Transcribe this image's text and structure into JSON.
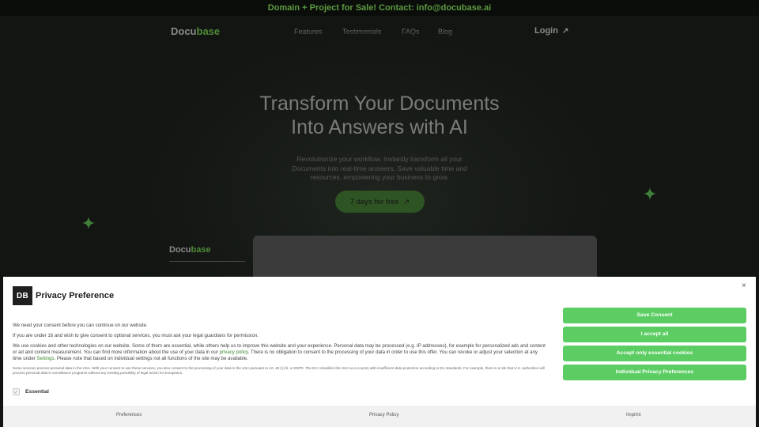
{
  "topbar": {
    "text": "Domain + Project for Sale! Contact: info@docubase.ai"
  },
  "nav": {
    "logo_main": "Docu",
    "logo_accent": "base",
    "links": [
      "Features",
      "Testimonials",
      "FAQs",
      "Blog"
    ],
    "login_label": "Login",
    "login_arrow": "↗"
  },
  "hero": {
    "title_line1": "Transform Your Documents",
    "title_line2": "Into Answers with AI",
    "subtitle": "Revolutionize your workflow. Instantly transform all your Documents into real-time answers. Save valuable time and resources, empowering your business to grow.",
    "cta_label": "7 days for free",
    "cta_arrow": "↗"
  },
  "preview": {
    "logo_main": "Docu",
    "logo_accent": "base"
  },
  "consent": {
    "badge": "DB",
    "title": "Privacy Preference",
    "close_glyph": "×",
    "p1": "We need your consent before you can continue on our website.",
    "p2": "If you are under 16 and wish to give consent to optional services, you must ask your legal guardians for permission.",
    "p3_a": "We use cookies and other technologies on our website. Some of them are essential, while others help us to improve this website and your experience. Personal data may be processed (e.g. IP addresses), for example for personalized ads and content or ad and content measurement. You can find more information about the use of your data in our ",
    "p3_link1": "privacy policy",
    "p3_b": ". There is no obligation to consent to the processing of your data in order to use this offer. You can revoke or adjust your selection at any time under ",
    "p3_link2": "Settings",
    "p3_c": ". Please note that based on individual settings not all functions of the site may be available.",
    "p4": "Some services process personal data in the USA. With your consent to use these services, you also consent to the processing of your data in the USA pursuant to Art. 49 (1) lit. a GDPR. The ECJ classifies the USA as a country with insufficient data protection according to EU standards. For example, there is a risk that U.S. authorities will process personal data in surveillance programs without any existing possibility of legal action for Europeans.",
    "essential_label": "Essential",
    "essential_check": "✓",
    "buttons": [
      "Save Consent",
      "I accept all",
      "Accept only essential cookies",
      "Individual Privacy Preferences"
    ],
    "footer_links": [
      "Preferences",
      "Privacy Policy",
      "Imprint"
    ]
  },
  "colors": {
    "accent_green": "#5bcd62",
    "dark_green": "#4f8a38",
    "link_green": "#3b8a2e"
  },
  "icons": [
    "sparkle-icon",
    "arrow-up-right-icon",
    "close-icon",
    "checkbox-check-icon"
  ]
}
